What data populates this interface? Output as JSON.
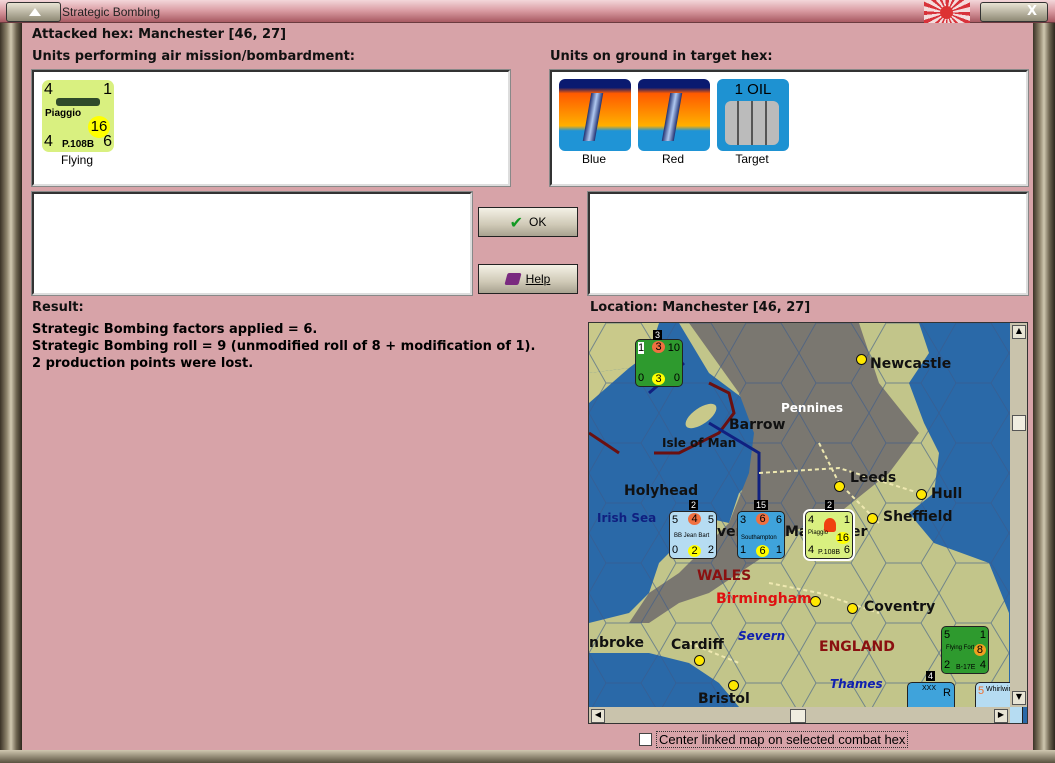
{
  "window": {
    "title": "Strategic Bombing"
  },
  "attacked_hex": "Attacked hex: Manchester  [46, 27]",
  "air_units": {
    "label": "Units performing air mission/bombardment:",
    "units": [
      {
        "name": "Piaggio",
        "model": "P.108B",
        "tl": "4",
        "tr": "1",
        "bl": "4",
        "br": "6",
        "range": "16",
        "status": "Flying",
        "color": "#d9f080"
      }
    ]
  },
  "ground_units": {
    "label": "Units on ground in target hex:",
    "units": [
      {
        "caption": "Blue",
        "icon": "factory-icon"
      },
      {
        "caption": "Red",
        "icon": "factory-icon"
      },
      {
        "caption": "Target",
        "icon": "oil-barrels-icon",
        "text": "1 OIL"
      }
    ]
  },
  "buttons": {
    "ok": "OK",
    "help": "Help"
  },
  "result": {
    "label": "Result:",
    "lines": [
      "Strategic Bombing factors applied = 6.",
      "Strategic Bombing roll = 9 (unmodified roll of 8 + modification of 1).",
      "2 production points were lost."
    ]
  },
  "location": {
    "label": "Location:  Manchester  [46, 27]"
  },
  "map": {
    "places": [
      "Newcastle",
      "Pennines",
      "Barrow",
      "Isle of Man",
      "Leeds",
      "Hull",
      "Holyhead",
      "Irish Sea",
      "Sheffield",
      "WALES",
      "Birmingham",
      "Coventry",
      "Severn",
      "nbroke",
      "Cardiff",
      "ENGLAND",
      "Thames",
      "Bristol",
      "Ma",
      "er",
      "ver"
    ],
    "counters": [
      {
        "stack": "3",
        "tl": "1",
        "tc": "3",
        "tr": "10",
        "bl": "0",
        "bc": "3",
        "br": "0",
        "color": "#2e9a2e"
      },
      {
        "stack": "2",
        "tl": "5",
        "tc": "4",
        "tr": "5",
        "name": "BB Jean Bart",
        "bl": "0",
        "bc": "2",
        "br": "2",
        "color": "#b6dcf2"
      },
      {
        "stack": "15",
        "tl": "3",
        "tc": "6",
        "tr": "6",
        "name": "Southampton",
        "bl": "1",
        "bc": "6",
        "br": "1",
        "color": "#3fa3db"
      },
      {
        "stack": "2",
        "tl": "4",
        "tr": "1",
        "name": "Piaggio",
        "range": "16",
        "bl": "4",
        "model": "P.108B",
        "br": "6",
        "color": "#d9f080"
      },
      {
        "tl": "5",
        "tr": "1",
        "name": "Flying Fort",
        "range": "8",
        "bl": "2",
        "model": "B-17E",
        "br": "4",
        "color": "#2e9a2e"
      },
      {
        "stack": "4",
        "corps": "XXX",
        "tr": "R"
      },
      {
        "tl": "5",
        "name": "Whirlwin"
      }
    ]
  },
  "checkbox": {
    "label": "Center linked map on selected combat hex",
    "checked": false
  }
}
